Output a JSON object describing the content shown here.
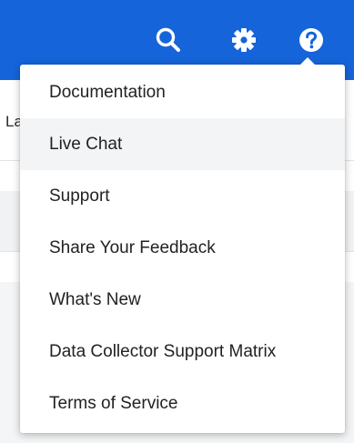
{
  "topbar": {
    "background": "#1664d9",
    "icons": [
      "search-icon",
      "gear-icon",
      "help-icon"
    ]
  },
  "background_view": {
    "header_fragment": "La"
  },
  "help_menu": {
    "items": [
      {
        "label": "Documentation",
        "hovered": false
      },
      {
        "label": "Live Chat",
        "hovered": true
      },
      {
        "label": "Support",
        "hovered": false
      },
      {
        "label": "Share Your Feedback",
        "hovered": false
      },
      {
        "label": "What's New",
        "hovered": false
      },
      {
        "label": "Data Collector Support Matrix",
        "hovered": false
      },
      {
        "label": "Terms of Service",
        "hovered": false
      }
    ]
  }
}
